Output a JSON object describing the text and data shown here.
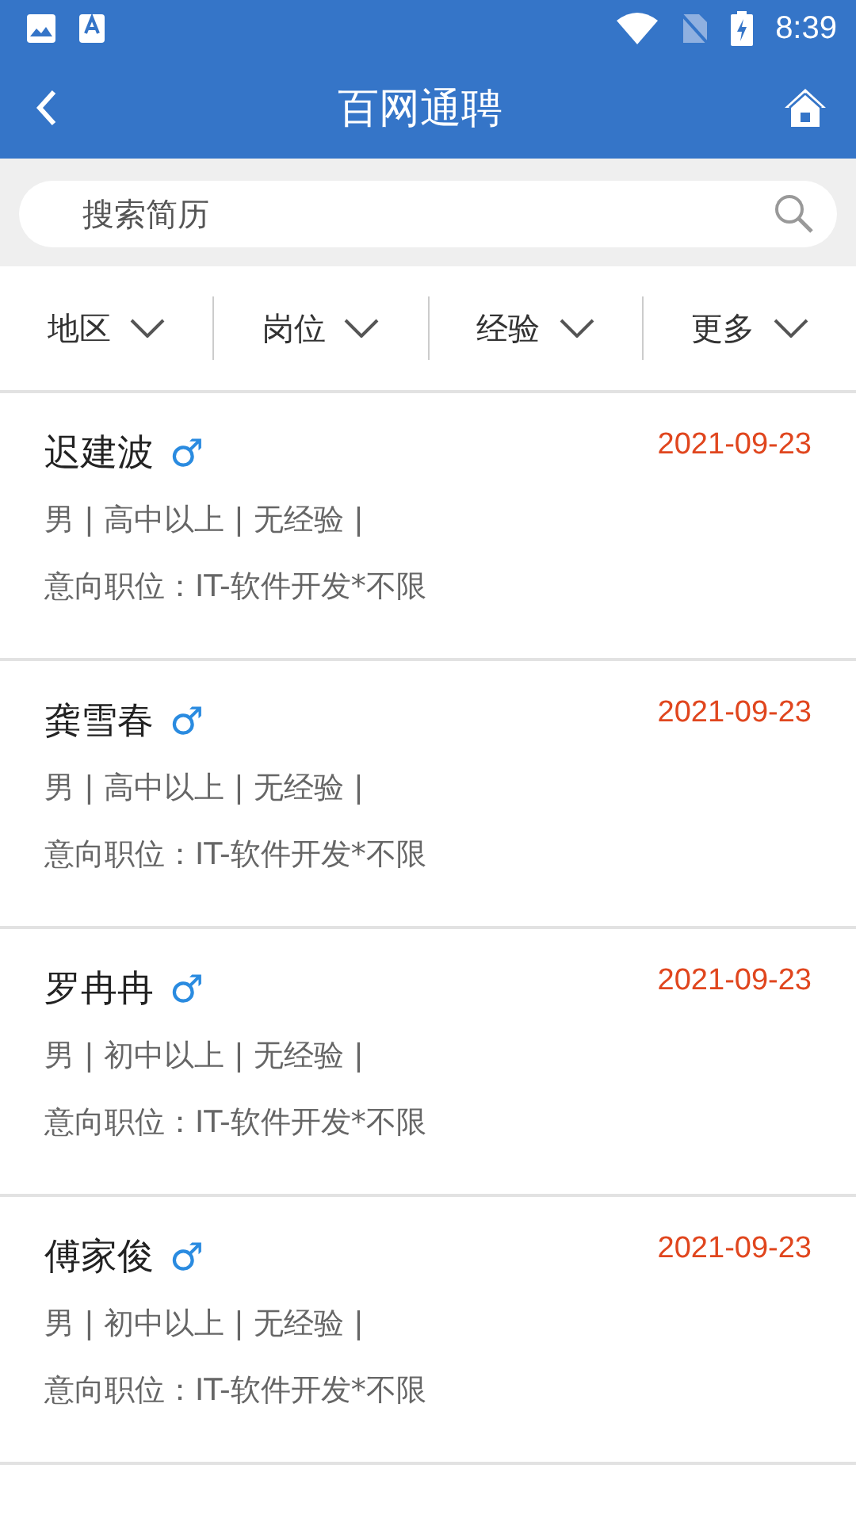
{
  "status_bar": {
    "time": "8:39"
  },
  "app_bar": {
    "title": "百网通聘"
  },
  "search": {
    "placeholder": "搜索简历"
  },
  "filters": [
    {
      "label": "地区"
    },
    {
      "label": "岗位"
    },
    {
      "label": "经验"
    },
    {
      "label": "更多"
    }
  ],
  "resumes": [
    {
      "name": "迟建波",
      "gender": "♂",
      "date": "2021-09-23",
      "info": "男 | 高中以上 | 无经验 |",
      "intent": "意向职位：IT-软件开发*不限"
    },
    {
      "name": "龚雪春",
      "gender": "♂",
      "date": "2021-09-23",
      "info": "男 | 高中以上 | 无经验 |",
      "intent": "意向职位：IT-软件开发*不限"
    },
    {
      "name": "罗冉冉",
      "gender": "♂",
      "date": "2021-09-23",
      "info": "男 | 初中以上 | 无经验 |",
      "intent": "意向职位：IT-软件开发*不限"
    },
    {
      "name": "傅家俊",
      "gender": "♂",
      "date": "2021-09-23",
      "info": "男 | 初中以上 | 无经验 |",
      "intent": "意向职位：IT-软件开发*不限"
    }
  ]
}
